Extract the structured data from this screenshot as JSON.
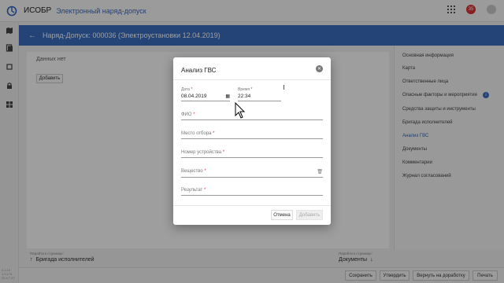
{
  "app": {
    "name": "ИСОБР",
    "title": "Электронный наряд-допуск",
    "notifications_count": "35"
  },
  "header": {
    "title": "Наряд-Допуск: 000036 (Электроустановки 12.04.2019)"
  },
  "main": {
    "empty_text": "Данных нет",
    "add_button": "Добавить"
  },
  "sidebar": {
    "version_lines": [
      "2.2.10",
      "1.0.176",
      "20.3.7.47"
    ]
  },
  "rightnav": {
    "items": [
      {
        "label": "Основная информация"
      },
      {
        "label": "Карта"
      },
      {
        "label": "Ответственные лица"
      },
      {
        "label": "Опасные факторы и мероприятия"
      },
      {
        "label": "Средства защиты и инструменты"
      },
      {
        "label": "Бригада исполнителей"
      },
      {
        "label": "Анализ ГВС",
        "active": true
      },
      {
        "label": "Документы"
      },
      {
        "label": "Комментарии"
      },
      {
        "label": "Журнал согласований"
      }
    ]
  },
  "pager": {
    "prev_hint": "Перейти к странице:",
    "prev_label": "Бригада исполнителей",
    "next_hint": "Перейти к странице:",
    "next_label": "Документы"
  },
  "footer": {
    "save": "Сохранить",
    "approve": "Утвердить",
    "return": "Вернуть на доработку",
    "print": "Печать"
  },
  "dialog": {
    "title": "Анализ ГВС",
    "date_label": "Дата",
    "date_value": "08.04.2019",
    "time_label": "Время",
    "time_value": "22:34",
    "fio_label": "ФИО",
    "place_label": "Место отбора",
    "device_label": "Номер устройства",
    "substance_label": "Вещество",
    "result_label": "Результат",
    "cancel": "Отмена",
    "add": "Добавить"
  },
  "colors": {
    "accent": "#3b6fc0",
    "required": "#d33333",
    "badge": "#dd3333"
  }
}
